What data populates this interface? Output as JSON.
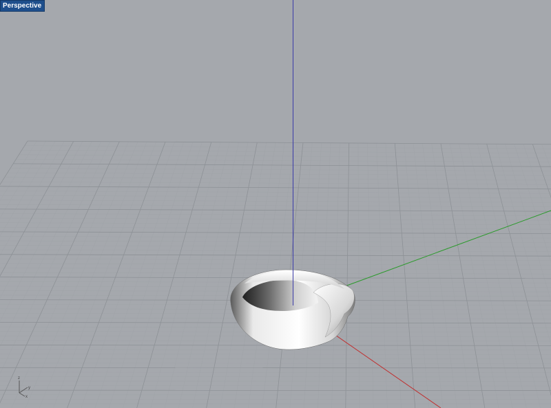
{
  "viewport": {
    "title": "Perspective",
    "background_color": "#a5a8ad",
    "title_tab_color": "#1f4f8c"
  },
  "grid": {
    "visible": true,
    "minor_line_color": "#9ea2a7",
    "major_line_color": "#8d9196"
  },
  "axes": {
    "x_color": "#c03030",
    "y_color": "#2a9a2a",
    "z_color": "#3a3aa8"
  },
  "model": {
    "shape": "mobius-band",
    "surface_color": "#f2f2f2",
    "shade_color": "#2b2b2b"
  },
  "axis_triad": {
    "x_label": "x",
    "y_label": "y",
    "z_label": "z"
  }
}
